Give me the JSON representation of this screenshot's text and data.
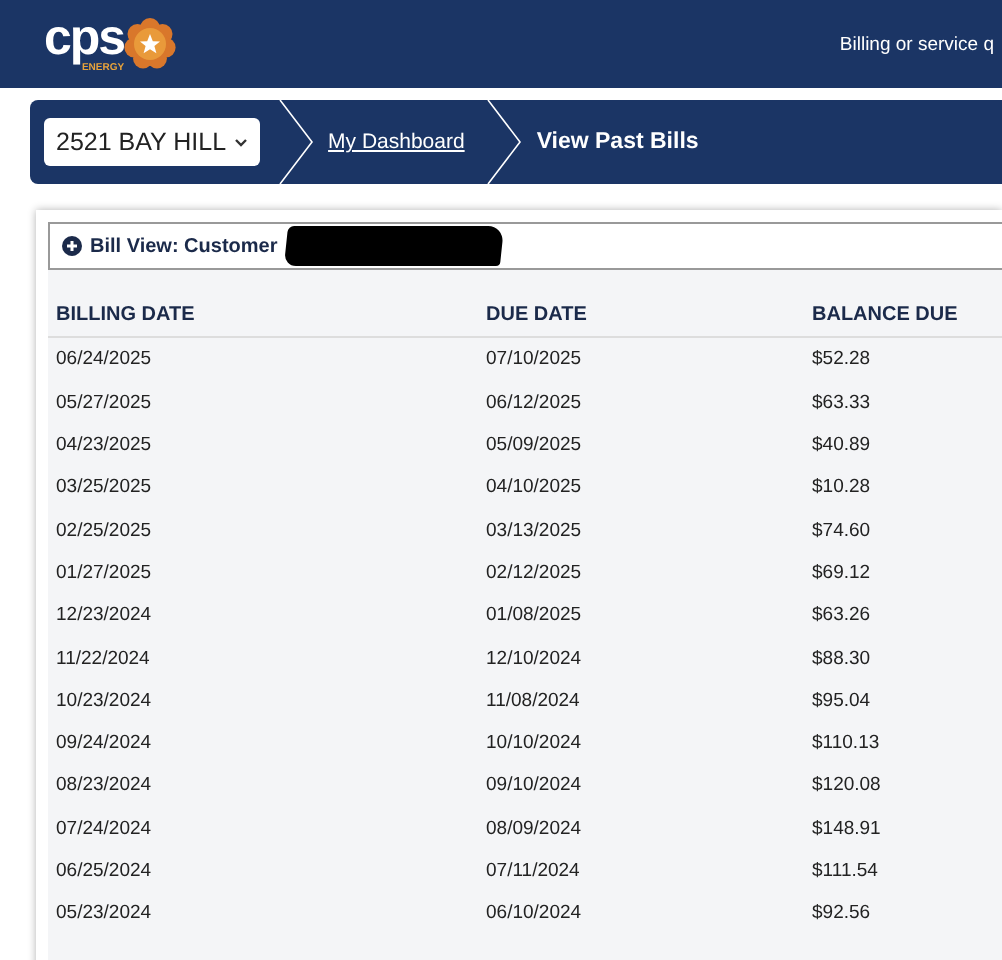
{
  "header": {
    "logo": {
      "wordmark": "cps",
      "subtitle": "ENERGY"
    },
    "link": "Billing or service q"
  },
  "breadcrumb": {
    "account": "2521 BAY HILL",
    "items": [
      {
        "label": "My Dashboard",
        "kind": "link"
      },
      {
        "label": "View Past Bills",
        "kind": "current"
      }
    ]
  },
  "panel": {
    "title": "Bill View: Customer",
    "expanded": false
  },
  "table": {
    "columns": [
      "BILLING DATE",
      "DUE DATE",
      "BALANCE DUE"
    ],
    "rows": [
      [
        "06/24/2025",
        "07/10/2025",
        "$52.28"
      ],
      [
        "05/27/2025",
        "06/12/2025",
        "$63.33"
      ],
      [
        "04/23/2025",
        "05/09/2025",
        "$40.89"
      ],
      [
        "03/25/2025",
        "04/10/2025",
        "$10.28"
      ],
      [
        "02/25/2025",
        "03/13/2025",
        "$74.60"
      ],
      [
        "01/27/2025",
        "02/12/2025",
        "$69.12"
      ],
      [
        "12/23/2024",
        "01/08/2025",
        "$63.26"
      ],
      [
        "11/22/2024",
        "12/10/2024",
        "$88.30"
      ],
      [
        "10/23/2024",
        "11/08/2024",
        "$95.04"
      ],
      [
        "09/24/2024",
        "10/10/2024",
        "$110.13"
      ],
      [
        "08/23/2024",
        "09/10/2024",
        "$120.08"
      ],
      [
        "07/24/2024",
        "08/09/2024",
        "$148.91"
      ],
      [
        "06/25/2024",
        "07/11/2024",
        "$111.54"
      ],
      [
        "05/23/2024",
        "06/10/2024",
        "$92.56"
      ]
    ]
  }
}
